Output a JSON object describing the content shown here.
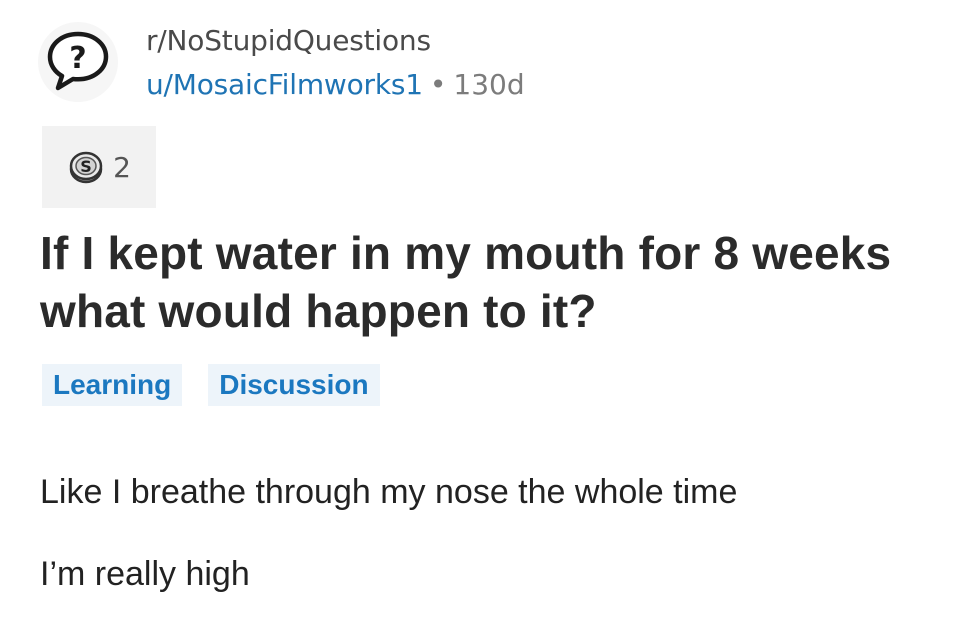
{
  "post": {
    "subreddit": "r/NoStupidQuestions",
    "author": "u/MosaicFilmworks1",
    "separator": "•",
    "age": "130d",
    "subreddit_icon": "question-mark-speech-bubble-icon",
    "award": {
      "icon": "silver-coin-icon",
      "count": "2"
    },
    "title": "If I kept water in my mouth for 8 weeks what would happen to it?",
    "flairs": [
      "Learning",
      "Discussion"
    ],
    "body": [
      "Like I breathe through my nose the whole time",
      "I’m really high"
    ]
  },
  "colors": {
    "link_blue": "#1f74b4",
    "flair_text": "#1b78c0",
    "flair_bg": "#edf4fa",
    "muted_gray": "#7c7c7c"
  }
}
